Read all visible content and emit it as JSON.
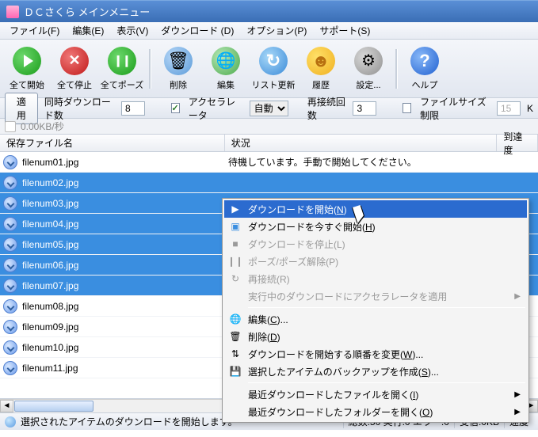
{
  "window": {
    "title": "ＤＣさくら メインメニュー"
  },
  "menubar": {
    "items": [
      "ファイル(F)",
      "編集(E)",
      "表示(V)",
      "ダウンロード (D)",
      "オプション(P)",
      "サポート(S)"
    ]
  },
  "toolbar": {
    "start_all": "全て開始",
    "stop_all": "全て停止",
    "pause_all": "全てポーズ",
    "delete": "削除",
    "edit": "編集",
    "refresh": "リスト更新",
    "history": "履歴",
    "settings": "設定...",
    "help": "ヘルプ"
  },
  "options": {
    "apply": "適用",
    "concurrent_label": "同時ダウンロード数",
    "concurrent_value": "8",
    "accel_label": "アクセラレータ",
    "accel_mode": "自動",
    "retry_label": "再接続回数",
    "retry_value": "3",
    "size_limit_label": "ファイルサイズ制限",
    "size_limit_value": "15"
  },
  "speed": {
    "rate": "0.00KB/秒"
  },
  "columns": {
    "name": "保存ファイル名",
    "status": "状況",
    "progress": "到達度"
  },
  "files": [
    {
      "name": "filenum01.jpg",
      "status": "待機しています。手動で開始してください。",
      "selected": false
    },
    {
      "name": "filenum02.jpg",
      "status": "",
      "selected": true
    },
    {
      "name": "filenum03.jpg",
      "status": "",
      "selected": true
    },
    {
      "name": "filenum04.jpg",
      "status": "",
      "selected": true
    },
    {
      "name": "filenum05.jpg",
      "status": "",
      "selected": true
    },
    {
      "name": "filenum06.jpg",
      "status": "",
      "selected": true
    },
    {
      "name": "filenum07.jpg",
      "status": "",
      "selected": true
    },
    {
      "name": "filenum08.jpg",
      "status": "",
      "selected": false
    },
    {
      "name": "filenum09.jpg",
      "status": "",
      "selected": false
    },
    {
      "name": "filenum10.jpg",
      "status": "",
      "selected": false
    },
    {
      "name": "filenum11.jpg",
      "status": "",
      "selected": false
    }
  ],
  "context_menu": {
    "start": {
      "pre": "ダウンロードを開始(",
      "u": "N",
      "post": ")"
    },
    "start_now": {
      "pre": "ダウンロードを今すぐ開始(",
      "u": "H",
      "post": ")"
    },
    "stop": "ダウンロードを停止(L)",
    "pause": "ポーズ/ポーズ解除(P)",
    "reconnect": "再接続(R)",
    "accel": "実行中のダウンロードにアクセラレータを適用",
    "edit": {
      "pre": "編集(",
      "u": "C",
      "post": ")..."
    },
    "delete": {
      "pre": "削除(",
      "u": "D",
      "post": ")"
    },
    "order": {
      "pre": "ダウンロードを開始する順番を変更(",
      "u": "W",
      "post": ")..."
    },
    "backup": {
      "pre": "選択したアイテムのバックアップを作成(",
      "u": "S",
      "post": ")..."
    },
    "recent_file": {
      "pre": "最近ダウンロードしたファイルを開く(",
      "u": "I",
      "post": ")"
    },
    "recent_folder": {
      "pre": "最近ダウンロードしたフォルダーを開く(",
      "u": "O",
      "post": ")"
    }
  },
  "statusbar": {
    "message": "選択されたアイテムのダウンロードを開始します。",
    "totals": "総数:50 実行:0 エラー:0",
    "recv": "受信:0KB",
    "speed": "速度"
  }
}
